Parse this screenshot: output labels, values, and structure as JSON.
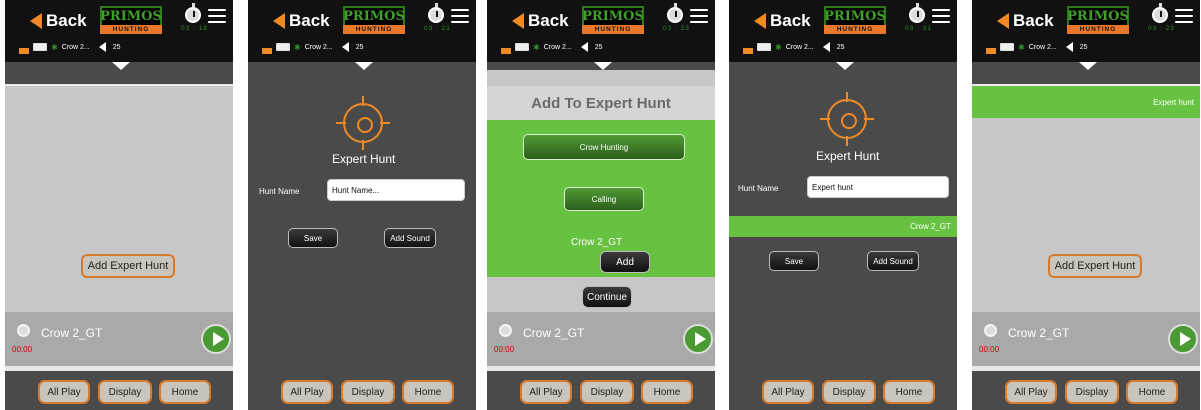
{
  "header": {
    "back_label": "Back",
    "logo_top": "PRIMOS",
    "logo_bottom": "HUNTING",
    "timer_text": "03 : 18",
    "sound_name": "Crow 2...",
    "volume": "25"
  },
  "header_timers": [
    "03 : 18",
    "03 : 21",
    "03 : 23",
    "03 : 31",
    "03 : 23"
  ],
  "player": {
    "track": "Crow 2_GT",
    "time": "00:00"
  },
  "footer": {
    "all_play": "All Play",
    "display": "Display",
    "home": "Home"
  },
  "screen1": {
    "add_expert_hunt": "Add Expert Hunt"
  },
  "screen2": {
    "title": "Expert Hunt",
    "hunt_name_label": "Hunt Name",
    "hunt_name_placeholder": "Hunt Name...",
    "save": "Save",
    "add_sound": "Add Sound"
  },
  "screen3": {
    "title": "Add To Expert Hunt",
    "category": "Crow Hunting",
    "subcategory": "Calling",
    "sound": "Crow 2_GT",
    "add": "Add",
    "continue": "Continue"
  },
  "screen4": {
    "title": "Expert Hunt",
    "hunt_name_label": "Hunt Name",
    "hunt_name_value": "Expert hunt",
    "sound_item": "Crow 2_GT",
    "save": "Save",
    "add_sound": "Add Sound"
  },
  "screen5": {
    "hunt_item": "Expert hunt",
    "add_expert_hunt": "Add Expert Hunt"
  }
}
